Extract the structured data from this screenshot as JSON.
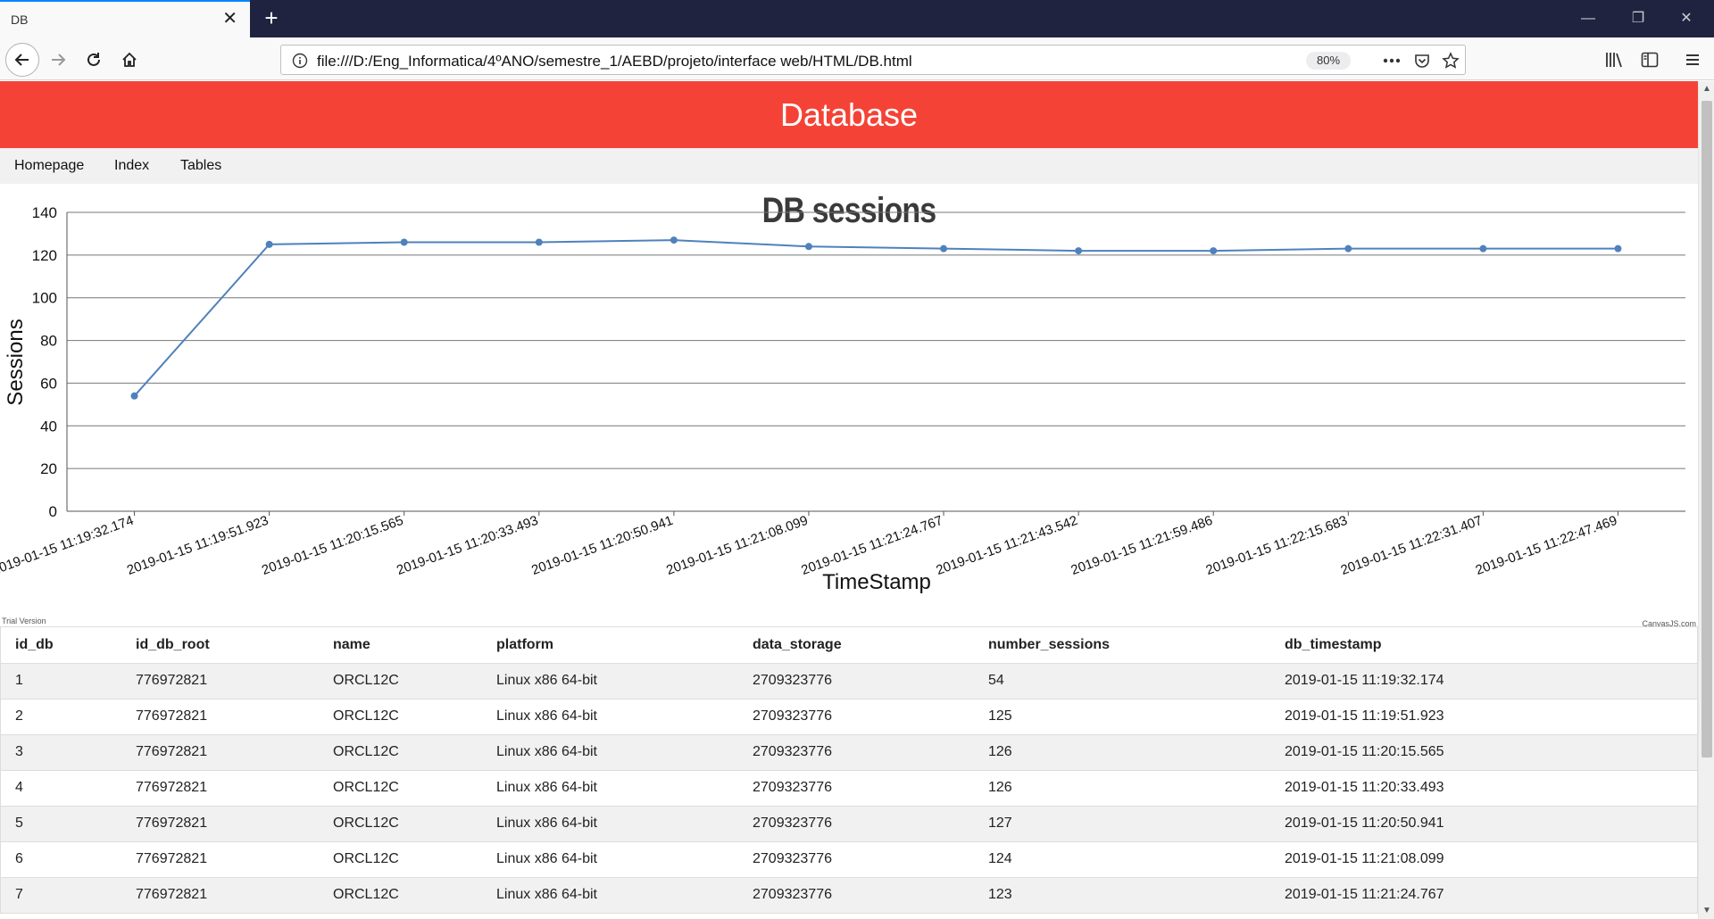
{
  "browser": {
    "tab_title": "DB",
    "url": "file:///D:/Eng_Informatica/4ºANO/semestre_1/AEBD/projeto/interface web/HTML/DB.html",
    "zoom": "80%"
  },
  "page": {
    "header": "Database",
    "nav": [
      "Homepage",
      "Index",
      "Tables"
    ],
    "trial_text": "Trial Version",
    "credit_text": "CanvasJS.com"
  },
  "chart_data": {
    "type": "line",
    "title": "DB sessions",
    "xlabel": "TimeStamp",
    "ylabel": "Sessions",
    "ylim": [
      0,
      140
    ],
    "yticks": [
      0,
      20,
      40,
      60,
      80,
      100,
      120,
      140
    ],
    "grid": true,
    "color": "#4f81bc",
    "categories": [
      "2019-01-15 11:19:32.174",
      "2019-01-15 11:19:51.923",
      "2019-01-15 11:20:15.565",
      "2019-01-15 11:20:33.493",
      "2019-01-15 11:20:50.941",
      "2019-01-15 11:21:08.099",
      "2019-01-15 11:21:24.767",
      "2019-01-15 11:21:43.542",
      "2019-01-15 11:21:59.486",
      "2019-01-15 11:22:15.683",
      "2019-01-15 11:22:31.407",
      "2019-01-15 11:22:47.469"
    ],
    "values": [
      54,
      125,
      126,
      126,
      127,
      124,
      123,
      122,
      122,
      123,
      123,
      123
    ]
  },
  "table": {
    "columns": [
      "id_db",
      "id_db_root",
      "name",
      "platform",
      "data_storage",
      "number_sessions",
      "db_timestamp"
    ],
    "rows": [
      [
        "1",
        "776972821",
        "ORCL12C",
        "Linux x86 64-bit",
        "2709323776",
        "54",
        "2019-01-15 11:19:32.174"
      ],
      [
        "2",
        "776972821",
        "ORCL12C",
        "Linux x86 64-bit",
        "2709323776",
        "125",
        "2019-01-15 11:19:51.923"
      ],
      [
        "3",
        "776972821",
        "ORCL12C",
        "Linux x86 64-bit",
        "2709323776",
        "126",
        "2019-01-15 11:20:15.565"
      ],
      [
        "4",
        "776972821",
        "ORCL12C",
        "Linux x86 64-bit",
        "2709323776",
        "126",
        "2019-01-15 11:20:33.493"
      ],
      [
        "5",
        "776972821",
        "ORCL12C",
        "Linux x86 64-bit",
        "2709323776",
        "127",
        "2019-01-15 11:20:50.941"
      ],
      [
        "6",
        "776972821",
        "ORCL12C",
        "Linux x86 64-bit",
        "2709323776",
        "124",
        "2019-01-15 11:21:08.099"
      ],
      [
        "7",
        "776972821",
        "ORCL12C",
        "Linux x86 64-bit",
        "2709323776",
        "123",
        "2019-01-15 11:21:24.767"
      ]
    ]
  }
}
